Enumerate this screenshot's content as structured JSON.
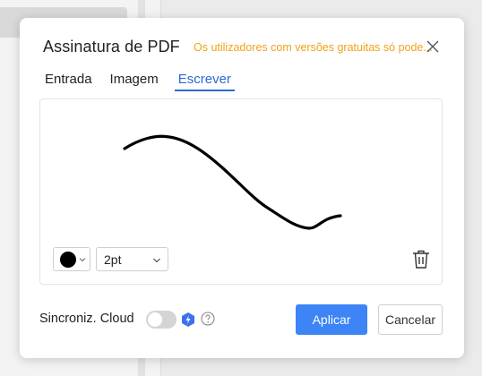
{
  "dialog": {
    "title": "Assinatura de PDF",
    "warning": "Os utilizadores com versões gratuitas só pode..."
  },
  "tabs": [
    {
      "label": "Entrada",
      "active": false
    },
    {
      "label": "Imagem",
      "active": false
    },
    {
      "label": "Escrever",
      "active": true
    }
  ],
  "toolbar": {
    "pen_color": "#000000",
    "pen_size": "2pt"
  },
  "footer": {
    "sync_label": "Sincroniz. Cloud",
    "sync_enabled": false,
    "apply_label": "Aplicar",
    "cancel_label": "Cancelar"
  },
  "colors": {
    "accent": "#3d84f7",
    "tab_active": "#2b6ad6",
    "warning": "#f0a21a"
  },
  "icons": [
    "close-icon",
    "chevron-down-icon",
    "trash-icon",
    "premium-icon",
    "help-icon"
  ]
}
